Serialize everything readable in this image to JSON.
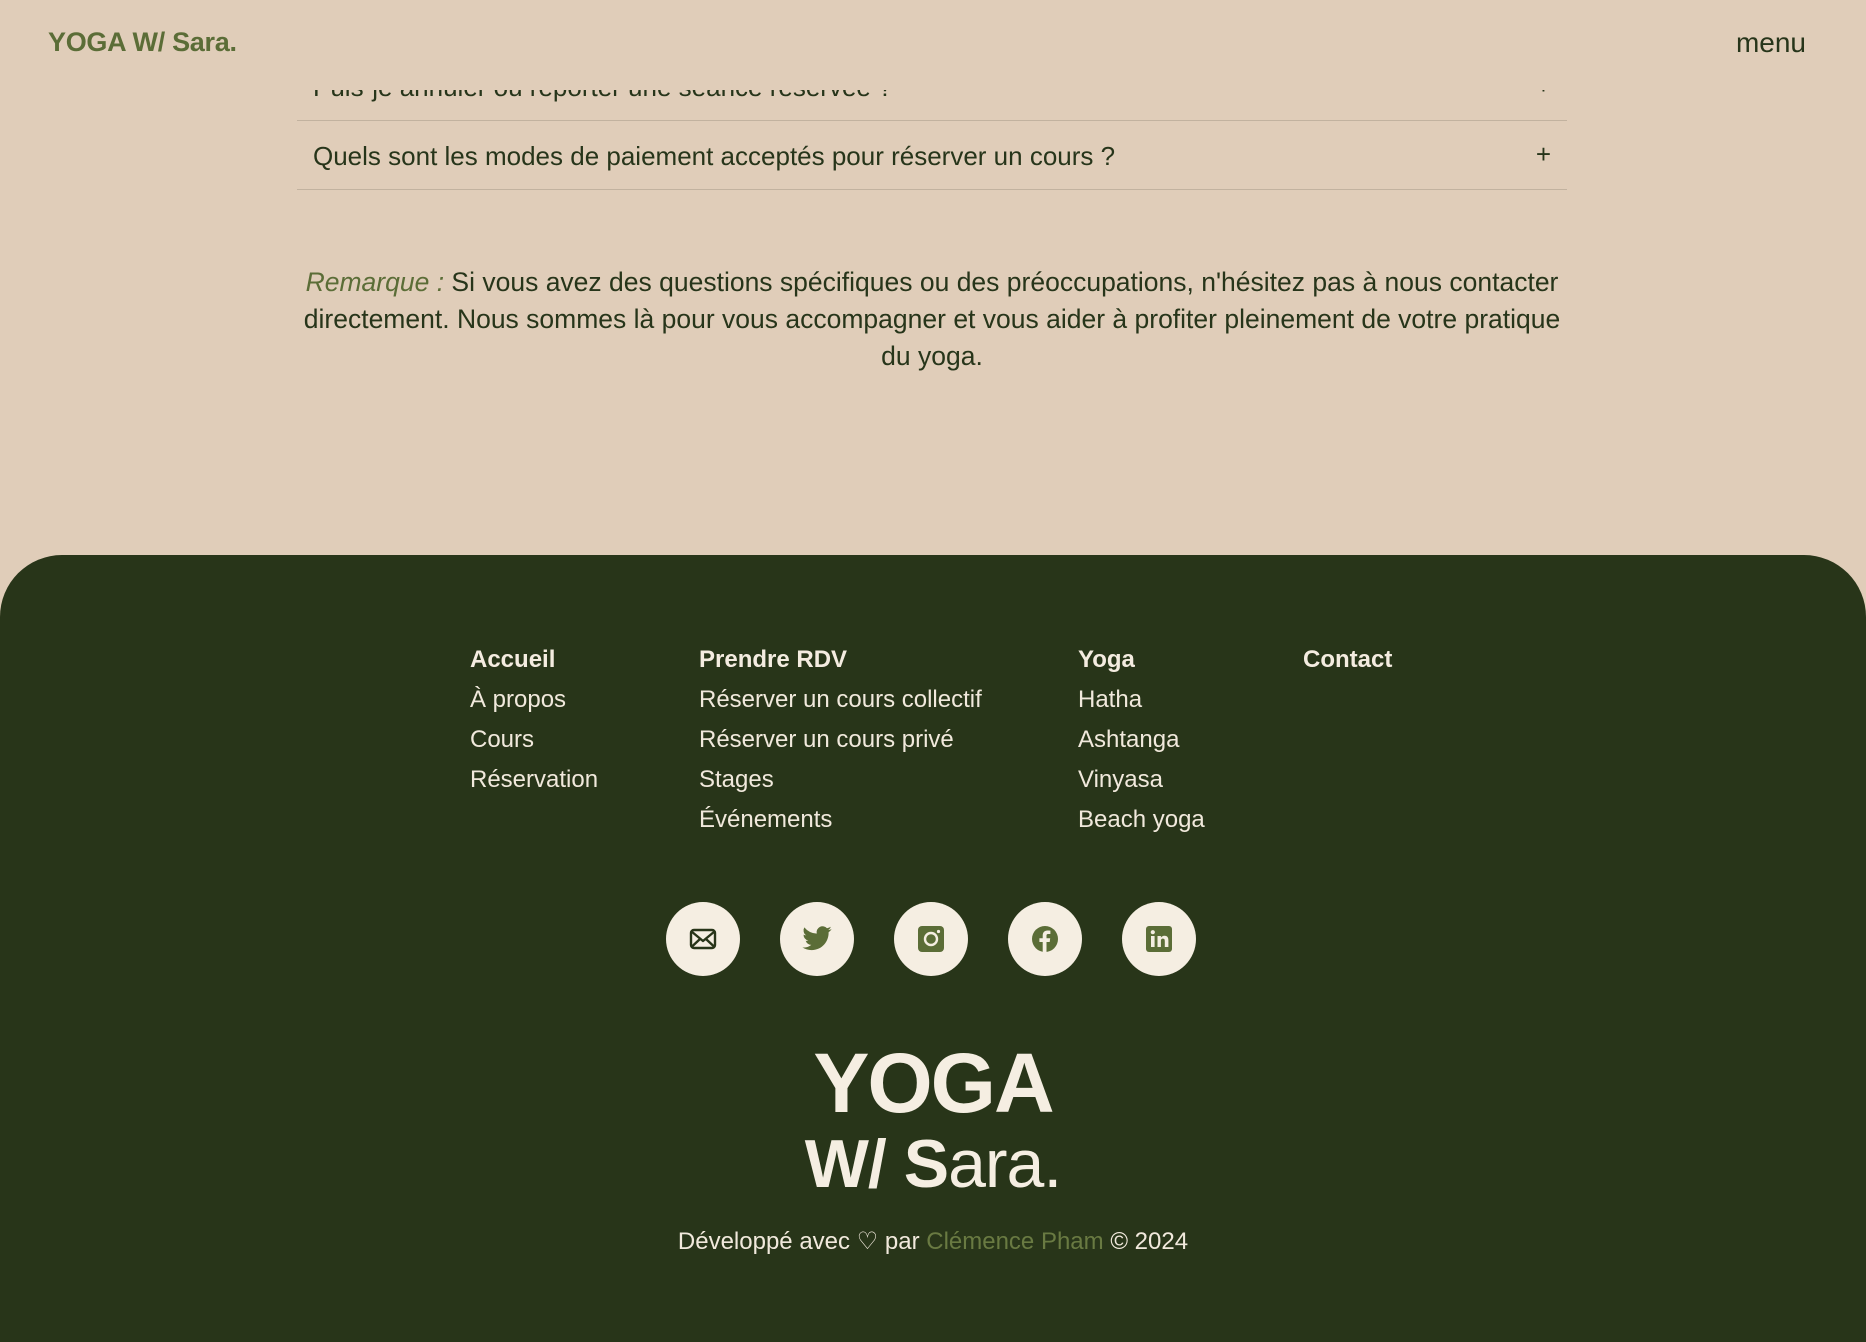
{
  "header": {
    "logo": "YOGA W/ Sara.",
    "menu_label": "menu"
  },
  "faq": {
    "items": [
      {
        "question": "Puis-je annuler ou reporter une séance réservée ?",
        "icon": "+"
      },
      {
        "question": "Quels sont les modes de paiement acceptés pour réserver un cours ?",
        "icon": "+"
      }
    ]
  },
  "remark": {
    "label": "Remarque :",
    "text": " Si vous avez des questions spécifiques ou des préoccupations, n'hésitez pas à nous contacter directement. Nous sommes là pour vous accompagner et vous aider à profiter pleinement de votre pratique du yoga."
  },
  "footer": {
    "columns": [
      {
        "heading": "Accueil",
        "links": [
          "À propos",
          "Cours",
          "Réservation"
        ]
      },
      {
        "heading": "Prendre RDV",
        "links": [
          "Réserver un cours collectif",
          "Réserver un cours privé",
          "Stages",
          "Événements"
        ]
      },
      {
        "heading": "Yoga",
        "links": [
          "Hatha",
          "Ashtanga",
          "Vinyasa",
          "Beach yoga"
        ]
      },
      {
        "heading": "Contact",
        "links": []
      }
    ],
    "socials": [
      "mail-icon",
      "twitter-icon",
      "instagram-icon",
      "facebook-icon",
      "linkedin-icon"
    ],
    "logo_line1": "YOGA",
    "logo_line2_bold": "W/ S",
    "logo_line2_rest": "ara.",
    "credits_prefix": "Développé avec ♡ par ",
    "credits_author": "Clémence Pham",
    "credits_suffix": " © 2024"
  },
  "colors": {
    "background": "#e0cdb9",
    "footer": "#283519",
    "accent": "#5b6d37",
    "cream": "#f5eee2"
  }
}
